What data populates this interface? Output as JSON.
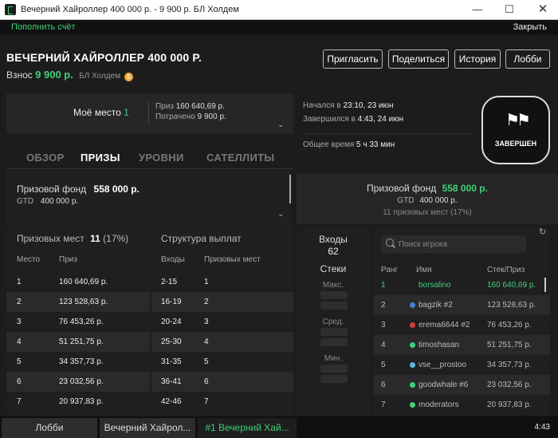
{
  "window": {
    "title": "Вечерний Хайроллер 400 000 р. - 9 900 р. БЛ Холдем"
  },
  "topbar": {
    "deposit": "Пополнить счёт",
    "close": "Закрыть"
  },
  "tournament": {
    "name": "ВЕЧЕРНИЙ ХАЙРОЛЛЕР 400 000 Р.",
    "buyin_label": "Взнос",
    "buyin": "9 900 р.",
    "game": "БЛ Холдем",
    "coin": "Б"
  },
  "header_buttons": {
    "invite": "Пригласить",
    "share": "Поделиться",
    "history": "История",
    "lobby": "Лобби"
  },
  "my_place": {
    "label": "Моё место",
    "value": "1",
    "prize_label": "Приз",
    "prize": "160 640,69 р.",
    "spent_label": "Потрачено",
    "spent": "9 900 р."
  },
  "tabs": [
    "ОБЗОР",
    "ПРИЗЫ",
    "УРОВНИ",
    "САТЕЛЛИТЫ"
  ],
  "pool_left": {
    "label": "Призовой фонд",
    "value": "558 000 р.",
    "gtd_label": "GTD",
    "gtd": "400 000 р."
  },
  "prize_places": {
    "label": "Призовых мест",
    "count": "11",
    "pct": "(17%)",
    "col_place": "Место",
    "col_prize": "Приз",
    "rows": [
      [
        "1",
        "160 640,69 р."
      ],
      [
        "2",
        "123 528,63 р."
      ],
      [
        "3",
        "76 453,26 р."
      ],
      [
        "4",
        "51 251,75 р."
      ],
      [
        "5",
        "34 357,73 р."
      ],
      [
        "6",
        "23 032,56 р."
      ],
      [
        "7",
        "20 937,83 р."
      ]
    ]
  },
  "payout_structure": {
    "label": "Структура выплат",
    "col_entries": "Входы",
    "col_places": "Призовых мест",
    "rows": [
      [
        "2-15",
        "1"
      ],
      [
        "16-19",
        "2"
      ],
      [
        "20-24",
        "3"
      ],
      [
        "25-30",
        "4"
      ],
      [
        "31-35",
        "5"
      ],
      [
        "36-41",
        "6"
      ],
      [
        "42-46",
        "7"
      ]
    ]
  },
  "status": {
    "started_label": "Начался в",
    "started": "23:10, 23 июн",
    "ended_label": "Завершился в",
    "ended": "4:43, 24 июн",
    "total_label": "Общее время",
    "total": "5 ч 33 мин",
    "badge": "ЗАВЕРШЕН"
  },
  "pool_right": {
    "label": "Призовой фонд",
    "value": "558 000 р.",
    "gtd_label": "GTD",
    "gtd": "400 000 р.",
    "places": "11 призовых мест (17%)"
  },
  "entries": {
    "label": "Входы",
    "value": "62",
    "stacks": "Стеки",
    "max": "Макс.",
    "avg": "Сред.",
    "min": "Мин."
  },
  "players": {
    "search_placeholder": "Поиск игрока",
    "col_rank": "Ранг",
    "col_name": "Имя",
    "col_stack": "Стек/Приз",
    "rows": [
      {
        "rank": "1",
        "name": "borsalino",
        "stack": "160 640,69 р.",
        "dot": "",
        "hl": true
      },
      {
        "rank": "2",
        "name": "bagzik #2",
        "stack": "123 528,63 р.",
        "dot": "#4a7fd8"
      },
      {
        "rank": "3",
        "name": "erema6644 #2",
        "stack": "76 453,26 р.",
        "dot": "#d83a3a"
      },
      {
        "rank": "4",
        "name": "timoshasan",
        "stack": "51 251,75 р.",
        "dot": "#3fd17a"
      },
      {
        "rank": "5",
        "name": "vse__prostoo",
        "stack": "34 357,73 р.",
        "dot": "#5ab8e8"
      },
      {
        "rank": "6",
        "name": "goodwhale #6",
        "stack": "23 032,56 р.",
        "dot": "#3fd17a"
      },
      {
        "rank": "7",
        "name": "moderators",
        "stack": "20 937,83 р.",
        "dot": "#3fd17a"
      }
    ]
  },
  "taskbar": {
    "lobby": "Лобби",
    "table1": "Вечерний Хайрол...",
    "table2": "#1 Вечерний Хай...",
    "clock": "4:43"
  },
  "colors": {
    "accent": "#3fd17a",
    "bg": "#1c1c1c"
  }
}
